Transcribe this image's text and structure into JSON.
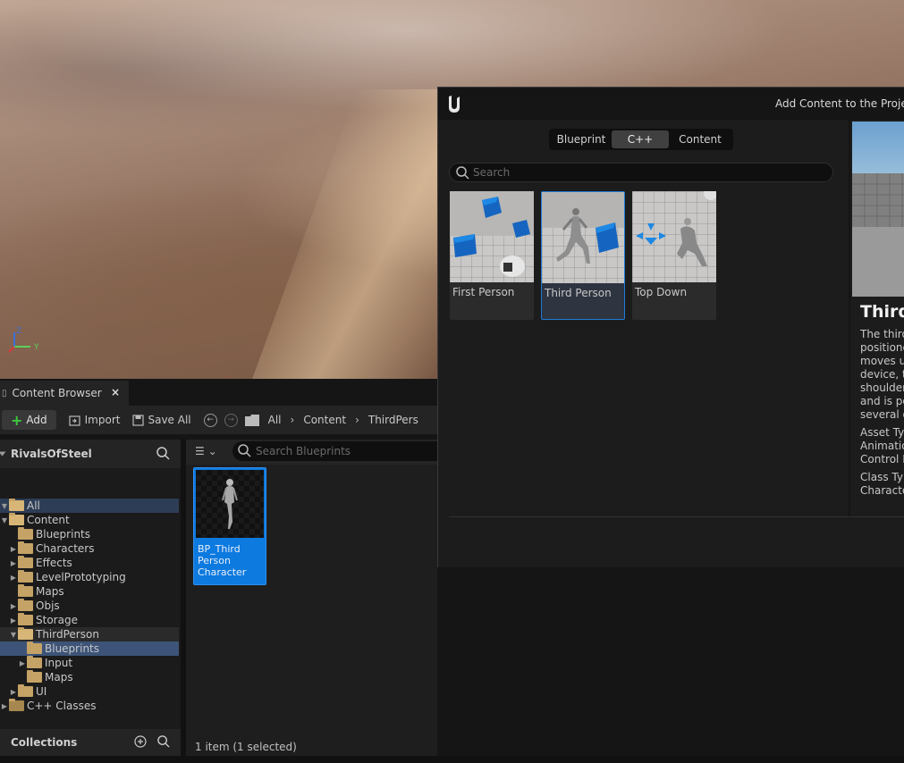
{
  "content_browser": {
    "tab_label": "Content Browser",
    "close_glyph": "×",
    "toolbar": {
      "add_label": "Add",
      "import_label": "Import",
      "save_all_label": "Save All"
    },
    "breadcrumbs": [
      "All",
      "Content",
      "ThirdPers"
    ],
    "sources": {
      "title": "RivalsOfSteel",
      "tree": [
        {
          "label": "All",
          "depth": 0,
          "caret": "▼",
          "open": true
        },
        {
          "label": "Content",
          "depth": 0,
          "caret": "▼",
          "open": true
        },
        {
          "label": "Blueprints",
          "depth": 1,
          "caret": ""
        },
        {
          "label": "Characters",
          "depth": 1,
          "caret": "▶"
        },
        {
          "label": "Effects",
          "depth": 1,
          "caret": "▶"
        },
        {
          "label": "LevelPrototyping",
          "depth": 1,
          "caret": "▶"
        },
        {
          "label": "Maps",
          "depth": 1,
          "caret": ""
        },
        {
          "label": "Objs",
          "depth": 1,
          "caret": "▶"
        },
        {
          "label": "Storage",
          "depth": 1,
          "caret": "▶"
        },
        {
          "label": "ThirdPerson",
          "depth": 1,
          "caret": "▼",
          "open": true
        },
        {
          "label": "Blueprints",
          "depth": 2,
          "caret": "",
          "selected": true
        },
        {
          "label": "Input",
          "depth": 2,
          "caret": "▶"
        },
        {
          "label": "Maps",
          "depth": 2,
          "caret": ""
        },
        {
          "label": "UI",
          "depth": 1,
          "caret": "▶"
        },
        {
          "label": "C++ Classes",
          "depth": 0,
          "caret": "▶",
          "cpp": true
        }
      ]
    },
    "collections_label": "Collections",
    "assets": {
      "search_placeholder": "Search Blueprints",
      "items": [
        {
          "name": "BP_Third Person Character",
          "selected": true
        }
      ],
      "status": "1 item (1 selected)"
    }
  },
  "dialog": {
    "title": "Add Content to the Projec",
    "tabs": [
      {
        "label": "Blueprint",
        "active": false
      },
      {
        "label": "C++",
        "active": true
      },
      {
        "label": "Content",
        "active": false
      }
    ],
    "search_placeholder": "Search",
    "templates": [
      {
        "label": "First Person",
        "selected": false
      },
      {
        "label": "Third Person",
        "selected": true
      },
      {
        "label": "Top Down",
        "selected": false
      }
    ],
    "preview": {
      "title": "Third P",
      "description": [
        "The third",
        "positione",
        "moves u",
        "device, th",
        "shoulder",
        "and is po",
        "several o"
      ],
      "asset_type_lines": [
        "Asset Ty",
        "Animatio",
        "Control F"
      ],
      "class_type_lines": [
        "Class Ty",
        "Characte"
      ]
    }
  },
  "viewport": {
    "gizmo_axes": [
      "Z",
      "Y"
    ]
  },
  "colors": {
    "accent_blue": "#0d7ae0",
    "folder": "#c5a265",
    "add_plus": "#3ecb3e"
  }
}
